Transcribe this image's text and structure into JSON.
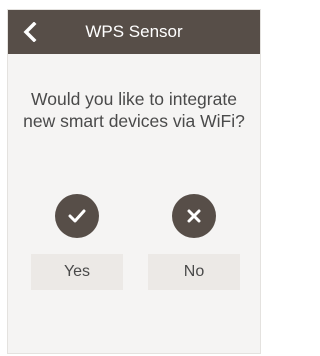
{
  "header": {
    "title": "WPS Sensor",
    "back_icon": "chevron-left-icon",
    "background": "#574e48"
  },
  "dialog": {
    "question": "Would you like to integrate new smart devices via WiFi?"
  },
  "options": {
    "yes": {
      "label": "Yes",
      "icon": "check-icon"
    },
    "no": {
      "label": "No",
      "icon": "close-icon"
    }
  },
  "colors": {
    "accent": "#574e48",
    "screen_background": "#f5f4f3",
    "button_background": "#ece9e6",
    "text": "#4a4a4a"
  }
}
